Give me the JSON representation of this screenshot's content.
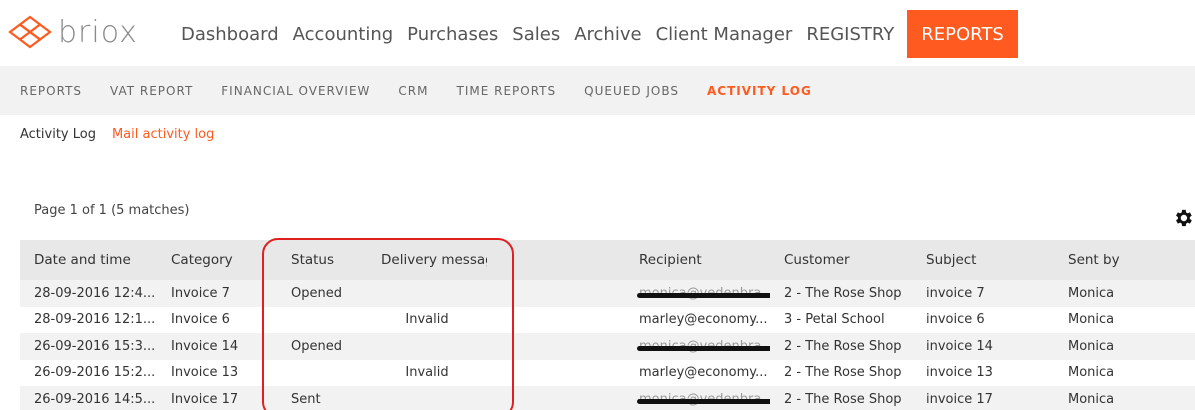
{
  "brand": {
    "name": "briox",
    "accent": "#ff5a1f"
  },
  "nav": [
    {
      "label": "Dashboard",
      "active": false
    },
    {
      "label": "Accounting",
      "active": false
    },
    {
      "label": "Purchases",
      "active": false
    },
    {
      "label": "Sales",
      "active": false
    },
    {
      "label": "Archive",
      "active": false
    },
    {
      "label": "Client Manager",
      "active": false
    },
    {
      "label": "REGISTRY",
      "active": false
    },
    {
      "label": "REPORTS",
      "active": true
    }
  ],
  "subnav": [
    {
      "label": "REPORTS",
      "active": false
    },
    {
      "label": "VAT REPORT",
      "active": false
    },
    {
      "label": "FINANCIAL OVERVIEW",
      "active": false
    },
    {
      "label": "CRM",
      "active": false
    },
    {
      "label": "TIME REPORTS",
      "active": false
    },
    {
      "label": "QUEUED JOBS",
      "active": false
    },
    {
      "label": "ACTIVITY LOG",
      "active": true
    }
  ],
  "tabs": {
    "activity_log": "Activity Log",
    "mail_activity_log": "Mail activity log"
  },
  "pagination": {
    "info": "Page 1 of 1  (5 matches)"
  },
  "icons": {
    "settings": "gear-icon"
  },
  "table": {
    "columns": [
      "Date and time",
      "Category",
      "Status",
      "Delivery message",
      "",
      "Recipient",
      "Customer",
      "Subject",
      "Sent by"
    ],
    "rows": [
      {
        "date": "28-09-2016 12:4...",
        "category": "Invoice 7",
        "status": "Opened",
        "delivery": "",
        "recipient": "monica@vedenbra...",
        "recipient_redacted": true,
        "customer": "2 - The Rose Shop",
        "subject": "invoice 7",
        "sent_by": "Monica"
      },
      {
        "date": "28-09-2016 12:1...",
        "category": "Invoice 6",
        "status": "",
        "delivery": "Invalid",
        "recipient": "marley@economy...",
        "recipient_redacted": false,
        "customer": "3 - Petal School",
        "subject": "invoice 6",
        "sent_by": "Monica"
      },
      {
        "date": "26-09-2016 15:3...",
        "category": "Invoice 14",
        "status": "Opened",
        "delivery": "",
        "recipient": "monica@vedenbra...",
        "recipient_redacted": true,
        "customer": "2 - The Rose Shop",
        "subject": "invoice 14",
        "sent_by": "Monica"
      },
      {
        "date": "26-09-2016 15:2...",
        "category": "Invoice 13",
        "status": "",
        "delivery": "Invalid",
        "recipient": "marley@economy...",
        "recipient_redacted": false,
        "customer": "2 - The Rose Shop",
        "subject": "invoice 13",
        "sent_by": "Monica"
      },
      {
        "date": "26-09-2016 14:5...",
        "category": "Invoice 17",
        "status": "Sent",
        "delivery": "",
        "recipient": "monica@vedenbra...",
        "recipient_redacted": true,
        "customer": "2 - The Rose Shop",
        "subject": "invoice 17",
        "sent_by": "Monica"
      }
    ]
  },
  "annotation": {
    "color": "#e02020"
  }
}
